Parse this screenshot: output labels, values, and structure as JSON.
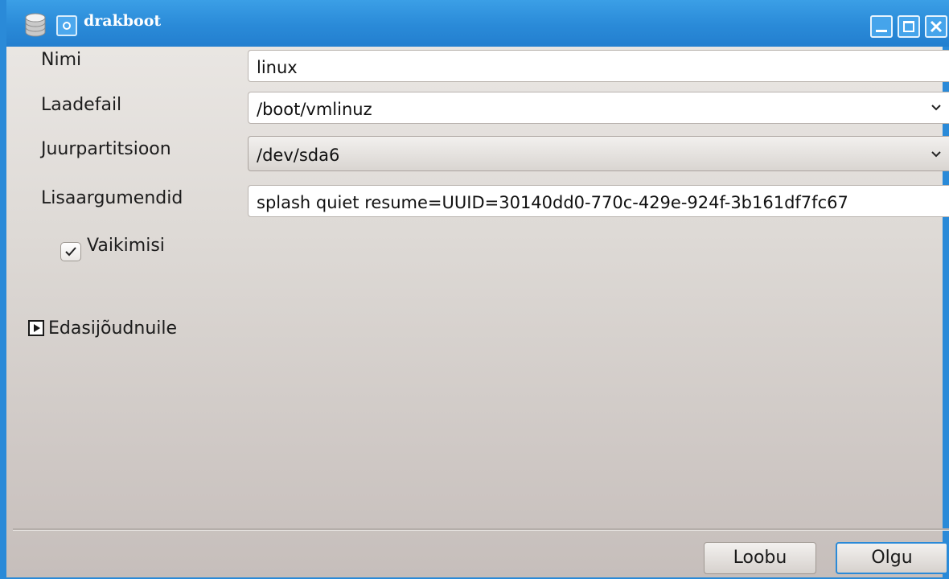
{
  "window": {
    "title": "drakboot",
    "accent_color": "#2a8ad8"
  },
  "icons": {
    "app": "database-icon",
    "title": "circle-icon"
  },
  "form": {
    "name_label": "Nimi",
    "name_value": "linux",
    "image_label": "Laadefail",
    "image_value": "/boot/vmlinuz",
    "root_label": "Juurpartitsioon",
    "root_value": "/dev/sda6",
    "append_label": "Lisaargumendid",
    "append_value": "splash quiet resume=UUID=30140dd0-770c-429e-924f-3b161df7fc67",
    "default_label": "Vaikimisi",
    "default_checked": true,
    "advanced_label": "Edasijõudnuile"
  },
  "buttons": {
    "cancel": "Loobu",
    "ok": "Olgu"
  }
}
